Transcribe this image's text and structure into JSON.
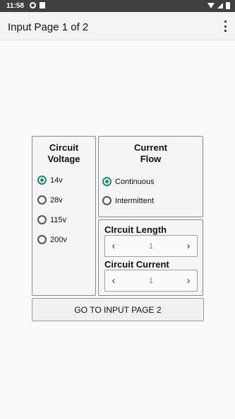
{
  "status_bar": {
    "time": "11:58",
    "icons": [
      "settings-icon",
      "sim-card-icon",
      "wifi-icon",
      "signal-icon",
      "battery-icon"
    ]
  },
  "app_bar": {
    "title": "Input Page 1 of 2",
    "menu_icon": "more-vert-icon"
  },
  "circuit_voltage": {
    "title_line1": "Circuit",
    "title_line2": "Voltage",
    "options": [
      "14v",
      "28v",
      "115v",
      "200v"
    ],
    "selected": "14v"
  },
  "current_flow": {
    "title_line1": "Current",
    "title_line2": "Flow",
    "options": [
      "Continuous",
      "Intermittent"
    ],
    "selected": "Continuous"
  },
  "circuit_length": {
    "label": "CIrcuit Length",
    "value": "1"
  },
  "circuit_current": {
    "label": "Circuit Current",
    "value": "1"
  },
  "go_button": {
    "label": "GO TO INPUT PAGE 2"
  },
  "colors": {
    "accent": "#1e8a6e",
    "status_bar": "#3f3f3f"
  }
}
